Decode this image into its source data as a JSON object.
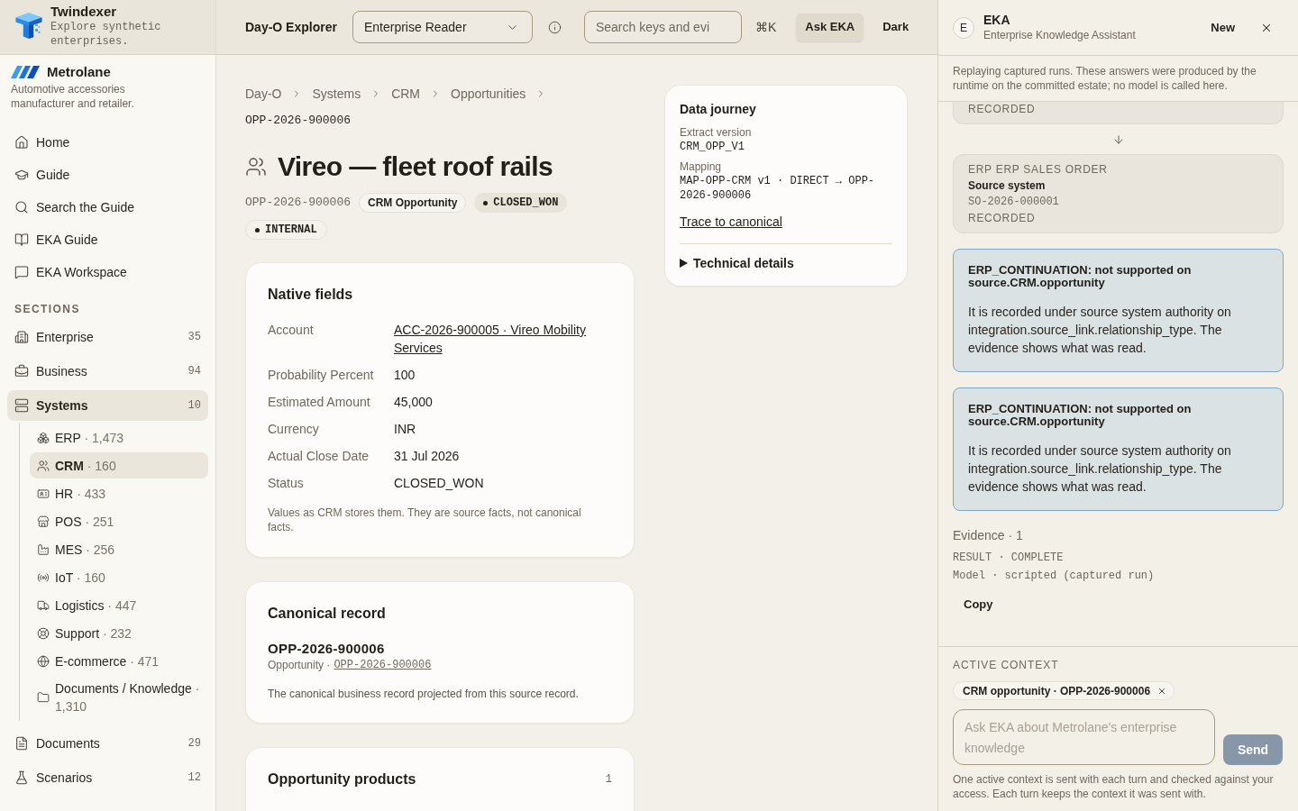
{
  "sidebar": {
    "brand": {
      "name": "Twindexer",
      "tagline": "Explore synthetic enterprises."
    },
    "enterprise": {
      "name": "Metrolane",
      "description": "Automotive accessories manufacturer and retailer."
    },
    "nav": [
      "Home",
      "Guide",
      "Search the Guide",
      "EKA Guide",
      "EKA Workspace"
    ],
    "sections": {
      "heading": "SECTIONS",
      "items": [
        {
          "label": "Enterprise",
          "count": "35",
          "selected": false
        },
        {
          "label": "Business",
          "count": "94",
          "selected": false
        },
        {
          "label": "Systems",
          "count": "10",
          "selected": true,
          "children": [
            {
              "label": "ERP",
              "count": "· 1,473",
              "selected": false
            },
            {
              "label": "CRM",
              "count": "· 160",
              "selected": true
            },
            {
              "label": "HR",
              "count": "· 433",
              "selected": false
            },
            {
              "label": "POS",
              "count": "· 251",
              "selected": false
            },
            {
              "label": "MES",
              "count": "· 256",
              "selected": false
            },
            {
              "label": "IoT",
              "count": "· 160",
              "selected": false
            },
            {
              "label": "Logistics",
              "count": "· 447",
              "selected": false
            },
            {
              "label": "Support",
              "count": "· 232",
              "selected": false
            },
            {
              "label": "E-commerce",
              "count": "· 471",
              "selected": false
            },
            {
              "label": "Documents / Knowledge",
              "count": "· 1,310",
              "selected": false
            }
          ]
        },
        {
          "label": "Documents",
          "count": "29",
          "selected": false
        },
        {
          "label": "Scenarios",
          "count": "12",
          "selected": false
        }
      ]
    }
  },
  "topbar": {
    "title": "Day-O Explorer",
    "role_select": {
      "value": "Enterprise Reader"
    },
    "search": {
      "placeholder": "Search keys and evi"
    },
    "shortcut": "⌘K",
    "buttons": [
      {
        "label": "Ask EKA",
        "selected": true
      },
      {
        "label": "Dark",
        "selected": false
      }
    ]
  },
  "breadcrumb": [
    "Day-O",
    "Systems",
    "CRM",
    "Opportunities",
    "OPP-2026-900006"
  ],
  "record": {
    "title": "Vireo — fleet roof rails",
    "id": "OPP-2026-900006",
    "tags": [
      {
        "label": "CRM Opportunity",
        "kind": "type"
      },
      {
        "label": "CLOSED_WON",
        "kind": "status"
      },
      {
        "label": "INTERNAL",
        "kind": "access"
      }
    ]
  },
  "native_fields": {
    "title": "Native fields",
    "fields": [
      {
        "label": "Account",
        "value": "ACC-2026-900005 · Vireo Mobility Services",
        "kind": "link"
      },
      {
        "label": "Probability Percent",
        "value": "100",
        "kind": "text"
      },
      {
        "label": "Estimated Amount",
        "value": "45,000",
        "kind": "text"
      },
      {
        "label": "Currency",
        "value": "INR",
        "kind": "text"
      },
      {
        "label": "Actual Close Date",
        "value": "31 Jul 2026",
        "kind": "text"
      },
      {
        "label": "Status",
        "value": "CLOSED_WON",
        "kind": "text"
      }
    ],
    "note": "Values as CRM stores them. They are source facts, not canonical facts."
  },
  "canonical_record": {
    "title": "Canonical record",
    "record_id": "OPP-2026-900006",
    "type": "Opportunity ·",
    "link": "OPP-2026-900006",
    "description": "The canonical business record projected from this source record."
  },
  "products": {
    "title": "Opportunity products",
    "count": "1"
  },
  "data_journey": {
    "title": "Data journey",
    "extract_label": "Extract version",
    "extract_value": "CRM_OPP_V1",
    "mapping_label": "Mapping",
    "mapping_value": "MAP-OPP-CRM v1 · DIRECT → OPP-2026-900006",
    "link": "Trace to canonical",
    "details": {
      "label": "Technical details",
      "expanded": false
    }
  },
  "assistant": {
    "avatar": "E",
    "title": "EKA",
    "subtitle": "Enterprise Knowledge Assistant",
    "new_button": "New",
    "notice": "Replaying captured runs. These answers were produced by the runtime on the committed estate; no model is called here.",
    "trail": [
      {
        "status": "RECORDED"
      },
      {
        "system": "ERP ERP SALES ORDER",
        "role": "Source system",
        "record": "SO-2026-000001",
        "status": "RECORDED"
      }
    ],
    "findings": [
      {
        "title": "ERP_CONTINUATION: not supported on source.CRM.opportunity",
        "body": "It is recorded under source system authority on integration.source_link.relationship_type. The evidence shows what was read."
      },
      {
        "title": "ERP_CONTINUATION: not supported on source.CRM.opportunity",
        "body": "It is recorded under source system authority on integration.source_link.relationship_type. The evidence shows what was read."
      }
    ],
    "evidence": {
      "label": "Evidence · 1",
      "result": "RESULT · COMPLETE",
      "model": "Model · scripted (captured run)",
      "copy_button": "Copy"
    },
    "context": {
      "heading": "ACTIVE CONTEXT",
      "chips": [
        {
          "label": "CRM opportunity · OPP-2026-900006"
        }
      ],
      "input": {
        "placeholder": "Ask EKA about Metrolane's enterprise knowledge"
      },
      "send": {
        "label": "Send",
        "disabled": true
      },
      "note": "One active context is sent with each turn and checked against your access. Each turn keeps the context it was sent with."
    }
  }
}
